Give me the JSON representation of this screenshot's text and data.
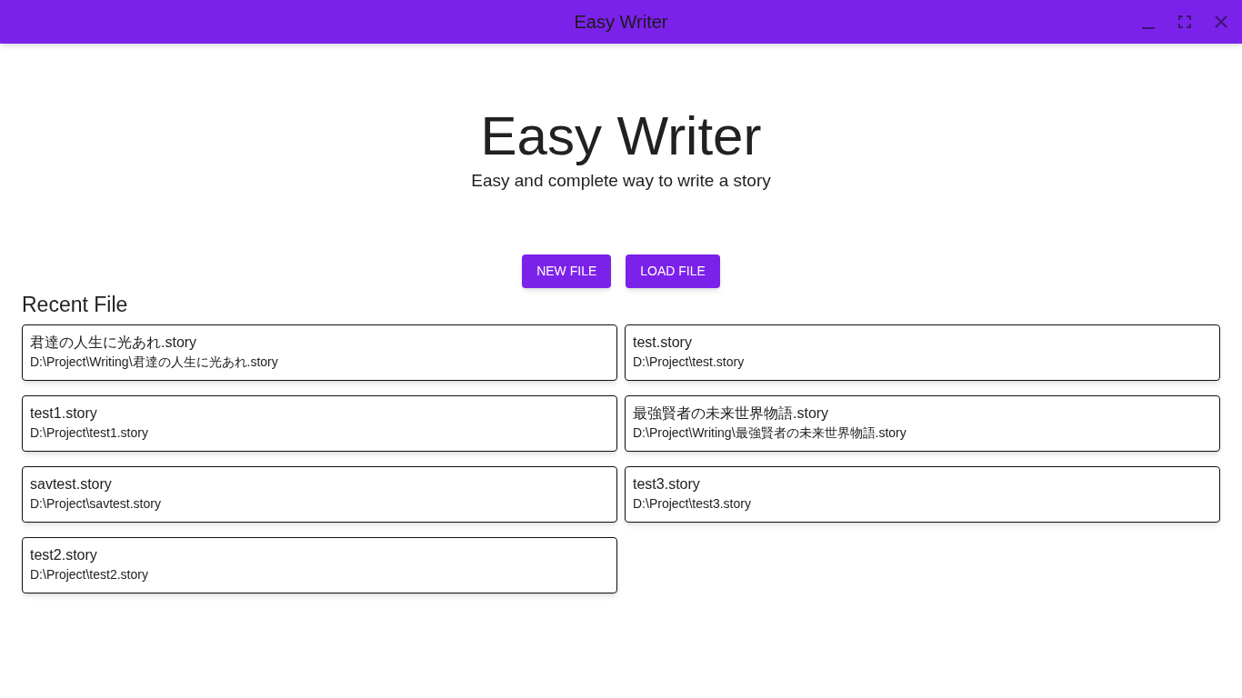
{
  "window": {
    "title": "Easy Writer"
  },
  "hero": {
    "title": "Easy Writer",
    "subtitle": "Easy and complete way to write a story"
  },
  "buttons": [
    "NEW FILE",
    "LOAD FILE"
  ],
  "recent": {
    "heading": "Recent File",
    "files": [
      {
        "name": "君達の人生に光あれ.story",
        "path": "D:\\Project\\Writing\\君達の人生に光あれ.story"
      },
      {
        "name": "test.story",
        "path": "D:\\Project\\test.story"
      },
      {
        "name": "test1.story",
        "path": "D:\\Project\\test1.story"
      },
      {
        "name": "最強賢者の未来世界物語.story",
        "path": "D:\\Project\\Writing\\最強賢者の未来世界物語.story"
      },
      {
        "name": "savtest.story",
        "path": "D:\\Project\\savtest.story"
      },
      {
        "name": "test3.story",
        "path": "D:\\Project\\test3.story"
      },
      {
        "name": "test2.story",
        "path": "D:\\Project\\test2.story"
      }
    ]
  }
}
